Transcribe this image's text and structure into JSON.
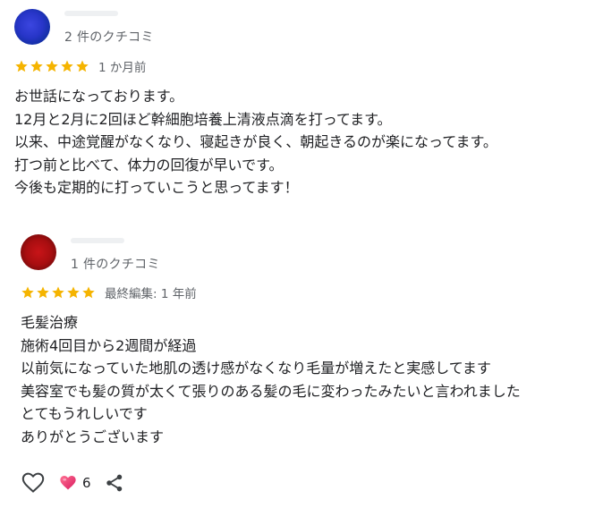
{
  "colors": {
    "star": "#f5b400",
    "text": "#202124",
    "secondary_text": "#5f6368",
    "reaction_heart": "#e8336d"
  },
  "reviews": [
    {
      "review_count": "2 件のクチコミ",
      "rating": 5,
      "date": "1 か月前",
      "lines": [
        "お世話になっております。",
        "12月と2月に2回ほど幹細胞培養上清液点滴を打ってます。",
        "以来、中途覚醒がなくなり、寝起きが良く、朝起きるのが楽になってます。",
        "打つ前と比べて、体力の回復が早いです。",
        "今後も定期的に打っていこうと思ってます！"
      ]
    },
    {
      "review_count": "1 件のクチコミ",
      "rating": 5,
      "date": "最終編集: 1 年前",
      "lines": [
        "毛髪治療",
        "施術4回目から2週間が経過",
        "以前気になっていた地肌の透け感がなくなり毛量が増えたと実感してます",
        "美容室でも髪の質が太くて張りのある髪の毛に変わったみたいと言われました",
        "とてもうれしいです",
        "ありがとうございます"
      ]
    }
  ],
  "actions": {
    "like_icon": "heart-outline-icon",
    "reaction_icon": "heart-filled-icon",
    "reaction_count": "6",
    "share_icon": "share-icon"
  }
}
